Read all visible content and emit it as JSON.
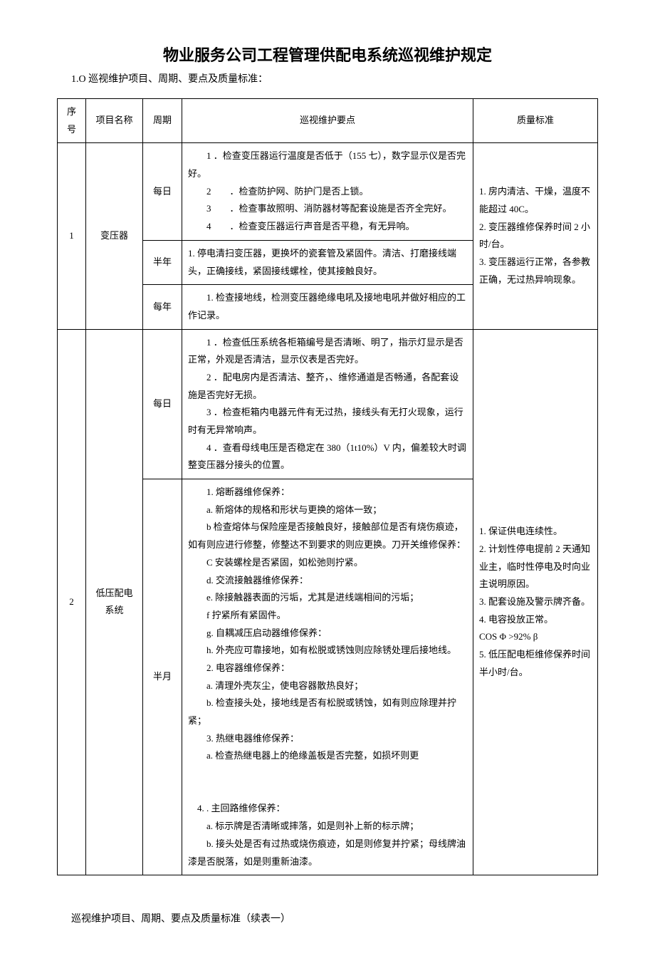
{
  "title": "物业服务公司工程管理供配电系统巡视维护规定",
  "subtitle": "1.O 巡视维护项目、周期、要点及质量标准：",
  "headers": {
    "seq": "序号",
    "name": "项目名称",
    "period": "周期",
    "points": "巡视维护要点",
    "standard": "质量标准"
  },
  "rows": [
    {
      "seq": "1",
      "name": "变压器",
      "periods": [
        {
          "period": "每日",
          "points": "　　1 ．检查变压器运行温度是否低于（155 七），数字显示仪是否完好。\n　　2　　．检查防护网、防护门是否上锁。\n　　3　　．检查事故照明、消防器材等配套设施是否齐全完好。\n　　4　　．检查变压器运行声音是否平稳，有无异响。"
        },
        {
          "period": "半年",
          "points": "1. 停电清扫变压器，更换坏的瓷套管及紧固件。清洁、打磨接线端头，正确接线，紧固接线螺栓，使其接触良好。"
        },
        {
          "period": "每年",
          "points": "　　1. 检查接地线，检测变压器绝缘电吼及接地电吼并做好相应的工作记录。"
        }
      ],
      "standard": "1. 房内清洁、干燥，温度不能超过 40C。\n2. 变压器维修保养时间 2 小时/台。\n3. 变压器运行正常，各参教正确，无过热异响现象。"
    },
    {
      "seq": "2",
      "name": "低压配电系统",
      "periods": [
        {
          "period": "每日",
          "points": "　　1 ．检查低压系统各柜箱编号是否清晰、明了，指示灯显示是否正常，外观是否清洁，显示仪表是否完好。\n　　2 ．配电房内是否清洁、整齐，、维修通道是否畅通，各配套设施是否完好无损。\n　　3 ．检查柜箱内电器元件有无过热，接线头有无打火现象，运行时有无异常响声。\n　　4 ．查看母线电压是否稳定在 380（1t10%）V 内，偏差较大时调整变压器分接头的位置。"
        },
        {
          "period": "半月",
          "points": "　　1. 熔断器维修保养：\n　　a. 新熔体的规格和形状与更换的熔体一致；\n　　b 检查熔体与保险座是否接触良好，接触部位是否有烧伤痕迹，如有则应进行修整，修整达不到要求的则应更换。刀开关维修保养：\n　　C 安装螺栓是否紧固，如松弛则拧紧。\n　　d. 交流接触器维修保养：\n　　e. 除接触器表面的污垢，尤其是进线端相间的污垢；\n　　f 拧紧所有紧固件。\n　　g. 自耦减压启动器维修保养：\n　　h. 外壳应可靠接地，如有松脱或锈蚀则应除锈处理后接地线。\n　　2. 电容器维修保养：\n　　a. 清理外壳灰尘，使电容器散热良好；\n　　b. 检查接头处，接地线是否有松脱或锈蚀，如有则应除理并拧紧；\n　　3. 热继电器维修保养：\n　　a. 检查热继电器上的绝缘盖板是否完整，如损坏则更\n\n　4.  . 主回路维修保养：\n　　a. 标示牌是否清晰或摔落，如是则补上新的标示牌；\n　　b. 接头处是否有过热或烧伤痕迹，如是则修复并拧紧；母线牌油漆是否脱落，如是则重新油漆。"
        }
      ],
      "standard": "1. 保证供电连续性。\n2. 计划性停电提前 2 天通知业主，临时性停电及时向业主说明原因。\n3. 配套设施及警示牌齐备。\n4. 电容投放正常。\nCOS Φ >92% β\n5. 低压配电柜维修保养时间半小时/台。"
    }
  ],
  "footer": "巡视维护项目、周期、要点及质量标准（续表一）"
}
